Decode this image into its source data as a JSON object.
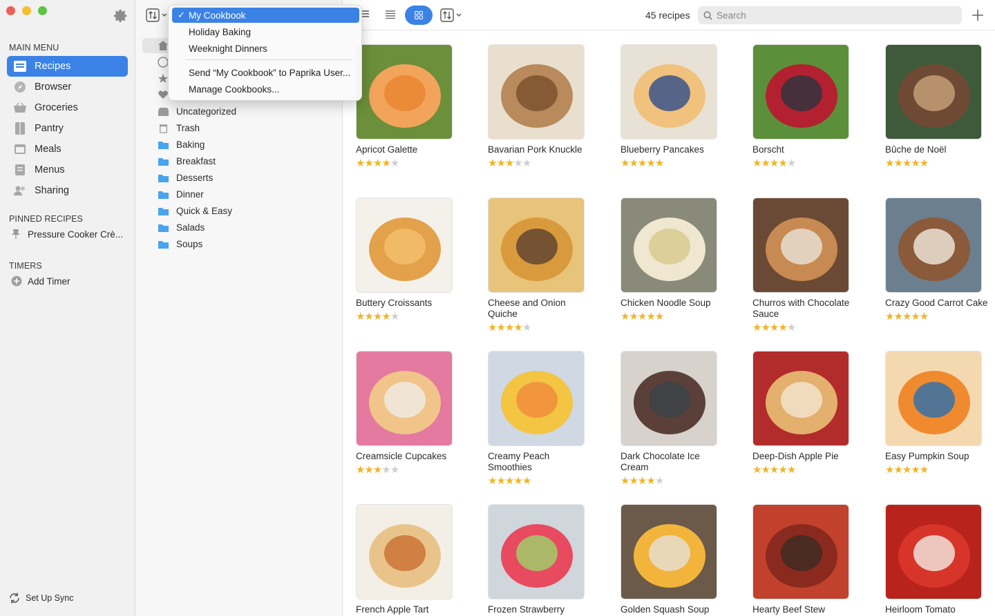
{
  "window": {
    "traffic_colors": [
      "#ee5f57",
      "#f5bd30",
      "#5fc342"
    ]
  },
  "sidebar": {
    "main_menu_heading": "MAIN MENU",
    "items": [
      {
        "label": "Recipes",
        "icon": "recipes-icon",
        "active": true
      },
      {
        "label": "Browser",
        "icon": "compass-icon"
      },
      {
        "label": "Groceries",
        "icon": "basket-icon"
      },
      {
        "label": "Pantry",
        "icon": "pantry-icon"
      },
      {
        "label": "Meals",
        "icon": "calendar-icon"
      },
      {
        "label": "Menus",
        "icon": "menu-list-icon"
      },
      {
        "label": "Sharing",
        "icon": "people-icon"
      }
    ],
    "pinned_heading": "PINNED RECIPES",
    "pinned_items": [
      "Pressure Cooker Crè..."
    ],
    "timers_heading": "TIMERS",
    "add_timer": "Add Timer",
    "sync": "Set Up Sync"
  },
  "categories": [
    "Uncategorized",
    "Trash",
    "Baking",
    "Breakfast",
    "Desserts",
    "Dinner",
    "Quick & Easy",
    "Salads",
    "Soups"
  ],
  "toolbar": {
    "count": "45 recipes",
    "search_placeholder": "Search"
  },
  "cookbook_menu": {
    "items": [
      "My Cookbook",
      "Holiday Baking",
      "Weeknight Dinners"
    ],
    "selected": "My Cookbook",
    "send": "Send “My Cookbook” to Paprika User...",
    "manage": "Manage Cookbooks..."
  },
  "recipes": [
    {
      "name": "Apricot Galette",
      "rating": 4
    },
    {
      "name": "Bavarian Pork Knuckle",
      "rating": 3
    },
    {
      "name": "Blueberry Pancakes",
      "rating": 5
    },
    {
      "name": "Borscht",
      "rating": 4
    },
    {
      "name": "Bûche de Noël",
      "rating": 5
    },
    {
      "name": "Buttery Croissants",
      "rating": 4
    },
    {
      "name": "Cheese and Onion Quiche",
      "rating": 4
    },
    {
      "name": "Chicken Noodle Soup",
      "rating": 5
    },
    {
      "name": "Churros with Chocolate Sauce",
      "rating": 4
    },
    {
      "name": "Crazy Good Carrot Cake",
      "rating": 5
    },
    {
      "name": "Creamsicle Cupcakes",
      "rating": 3
    },
    {
      "name": "Creamy Peach Smoothies",
      "rating": 5
    },
    {
      "name": "Dark Chocolate Ice Cream",
      "rating": 4
    },
    {
      "name": "Deep-Dish Apple Pie",
      "rating": 5
    },
    {
      "name": "Easy Pumpkin Soup",
      "rating": 5
    },
    {
      "name": "French Apple Tart",
      "rating": null
    },
    {
      "name": "Frozen Strawberry",
      "rating": null
    },
    {
      "name": "Golden Squash Soup",
      "rating": null
    },
    {
      "name": "Hearty Beef Stew",
      "rating": null
    },
    {
      "name": "Heirloom Tomato",
      "rating": null
    }
  ],
  "colors": {
    "accent": "#3b82e6",
    "star": "#f0b429",
    "star_off": "#cfcfcf"
  }
}
